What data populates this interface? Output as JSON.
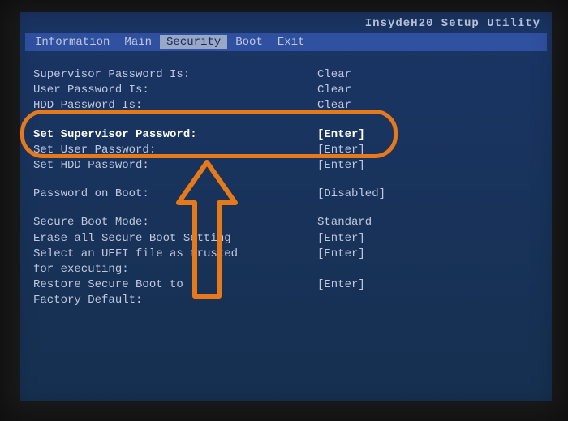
{
  "title": "InsydeH20 Setup Utility",
  "menu": {
    "items": [
      "Information",
      "Main",
      "Security",
      "Boot",
      "Exit"
    ],
    "active": "Security"
  },
  "status": {
    "supervisor_label": "Supervisor Password Is:",
    "supervisor_value": "Clear",
    "user_label": "User Password Is:",
    "user_value": "Clear",
    "hdd_label": "HDD Password Is:",
    "hdd_value": "Clear"
  },
  "actions": {
    "set_supervisor_label": "Set Supervisor Password:",
    "set_supervisor_value": "[Enter]",
    "set_user_label": "Set User Password:",
    "set_user_value": "[Enter]",
    "set_hdd_label": "Set HDD Password:",
    "set_hdd_value": "[Enter]"
  },
  "boot": {
    "pwd_on_boot_label": "Password on Boot:",
    "pwd_on_boot_value": "[Disabled]"
  },
  "secure": {
    "mode_label": "Secure Boot Mode:",
    "mode_value": "Standard",
    "erase_label": "Erase all Secure Boot Setting",
    "erase_value": "[Enter]",
    "select_label_1": "Select an UEFI file as trusted",
    "select_label_2": "for executing:",
    "select_value": "[Enter]",
    "restore_label_1": "Restore Secure Boot to",
    "restore_label_2": "Factory Default:",
    "restore_value": "[Enter]"
  }
}
